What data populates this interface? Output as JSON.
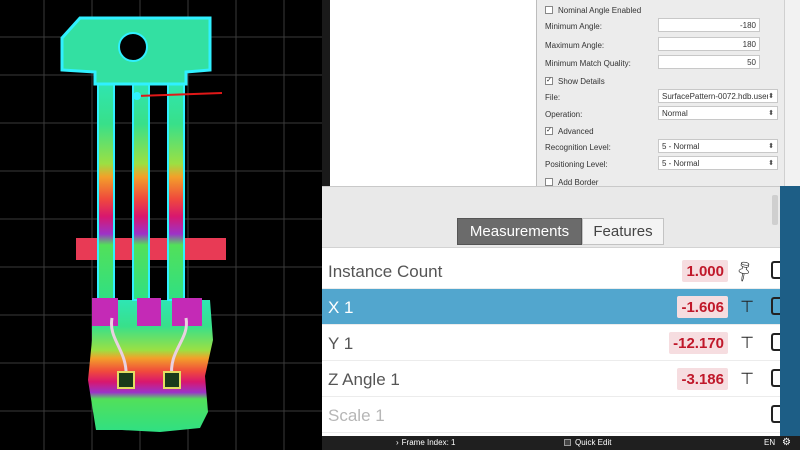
{
  "settings": {
    "nominal_angle_label": "Nominal Angle Enabled",
    "min_angle_label": "Minimum Angle:",
    "min_angle_value": "-180",
    "max_angle_label": "Maximum Angle:",
    "max_angle_value": "180",
    "min_match_label": "Minimum Match Quality:",
    "min_match_value": "50",
    "show_details_label": "Show Details",
    "file_label": "File:",
    "file_value": "SurfacePattern-0072.hdb.user",
    "operation_label": "Operation:",
    "operation_value": "Normal",
    "advanced_label": "Advanced",
    "recognition_label": "Recognition Level:",
    "recognition_value": "5 - Normal",
    "positioning_label": "Positioning Level:",
    "positioning_value": "5 - Normal",
    "add_border_label": "Add Border",
    "checked": {
      "nominal_angle": false,
      "show_details": true,
      "advanced": true,
      "add_border": false
    }
  },
  "measurements": {
    "tabs": {
      "measurements": "Measurements",
      "features": "Features"
    },
    "rows": [
      {
        "label": "Instance Count",
        "value": "1.000",
        "selected": false,
        "dimmed": false
      },
      {
        "label": "X 1",
        "value": "-1.606",
        "selected": true,
        "dimmed": false
      },
      {
        "label": "Y 1",
        "value": "-12.170",
        "selected": false,
        "dimmed": false
      },
      {
        "label": "Z Angle 1",
        "value": "-3.186",
        "selected": false,
        "dimmed": false
      },
      {
        "label": "Scale 1",
        "value": "",
        "selected": false,
        "dimmed": true
      }
    ]
  },
  "statusbar": {
    "frame_index": "Frame Index: 1",
    "quick_edit": "Quick Edit",
    "lang": "EN"
  },
  "icons": {
    "pin": "pushpin-icon",
    "check": "checkbox-icon",
    "gear": "gear-icon"
  }
}
